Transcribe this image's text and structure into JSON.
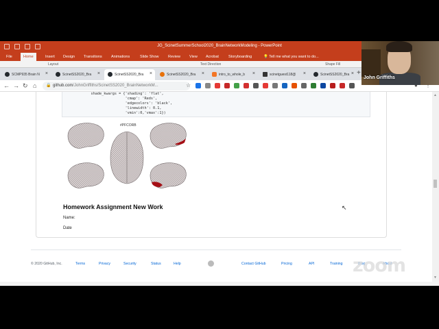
{
  "powerpoint": {
    "doc_title": "JG_ScinetSummerSchool2020_BrainNetworkModeling - PowerPoint",
    "menu": [
      "File",
      "Home",
      "Insert",
      "Design",
      "Transitions",
      "Animations",
      "Slide Show",
      "Review",
      "View",
      "Acrobat",
      "Storyboarding"
    ],
    "tell_me": "Tell me what you want to do...",
    "ribbon_layout": "Layout",
    "ribbon_text_direction": "Text Direction",
    "ribbon_shape_fill": "Shape Fill"
  },
  "browser": {
    "tabs": [
      {
        "label": "SCMP935 Brain N",
        "color": "#24292e"
      },
      {
        "label": "ScinetSS2020_Bra",
        "color": "#24292e"
      },
      {
        "label": "ScinetSS2020_Bra",
        "color": "#24292e"
      },
      {
        "label": "ScinetSS2020_Bra",
        "color": "#e8710a"
      },
      {
        "label": "intro_to_whole_b",
        "color": "#f37626"
      },
      {
        "label": "scinetguest118@",
        "color": "#333"
      },
      {
        "label": "ScinetSS2020_Bra",
        "color": "#24292e"
      }
    ],
    "tab_close": "×",
    "new_tab": "+",
    "url_host": "github.com",
    "url_path": "/JohnGriffiths/ScinetSS2020_BrainNetworkM..."
  },
  "page": {
    "code_lines": [
      "            shade_kwargs = {'shading': 'flat',",
      "                            'cmap': 'Reds',",
      "                            'edgecolors': 'black',",
      "                            'linewidth': 0.1,",
      "                            'vmin':0,'vmax':1})"
    ],
    "figure_label": "#PFCORB",
    "homework_title": "Homework Assignment New Work",
    "name_label": "Name:",
    "date_label": "Date"
  },
  "footer": {
    "copyright": "© 2020 GitHub, Inc.",
    "links": [
      "Terms",
      "Privacy",
      "Security",
      "Status",
      "Help",
      "Contact GitHub",
      "Pricing",
      "API",
      "Training",
      "Blog",
      "About"
    ]
  },
  "video": {
    "participant_name": "John Griffiths"
  },
  "zoom_watermark": "zoom"
}
